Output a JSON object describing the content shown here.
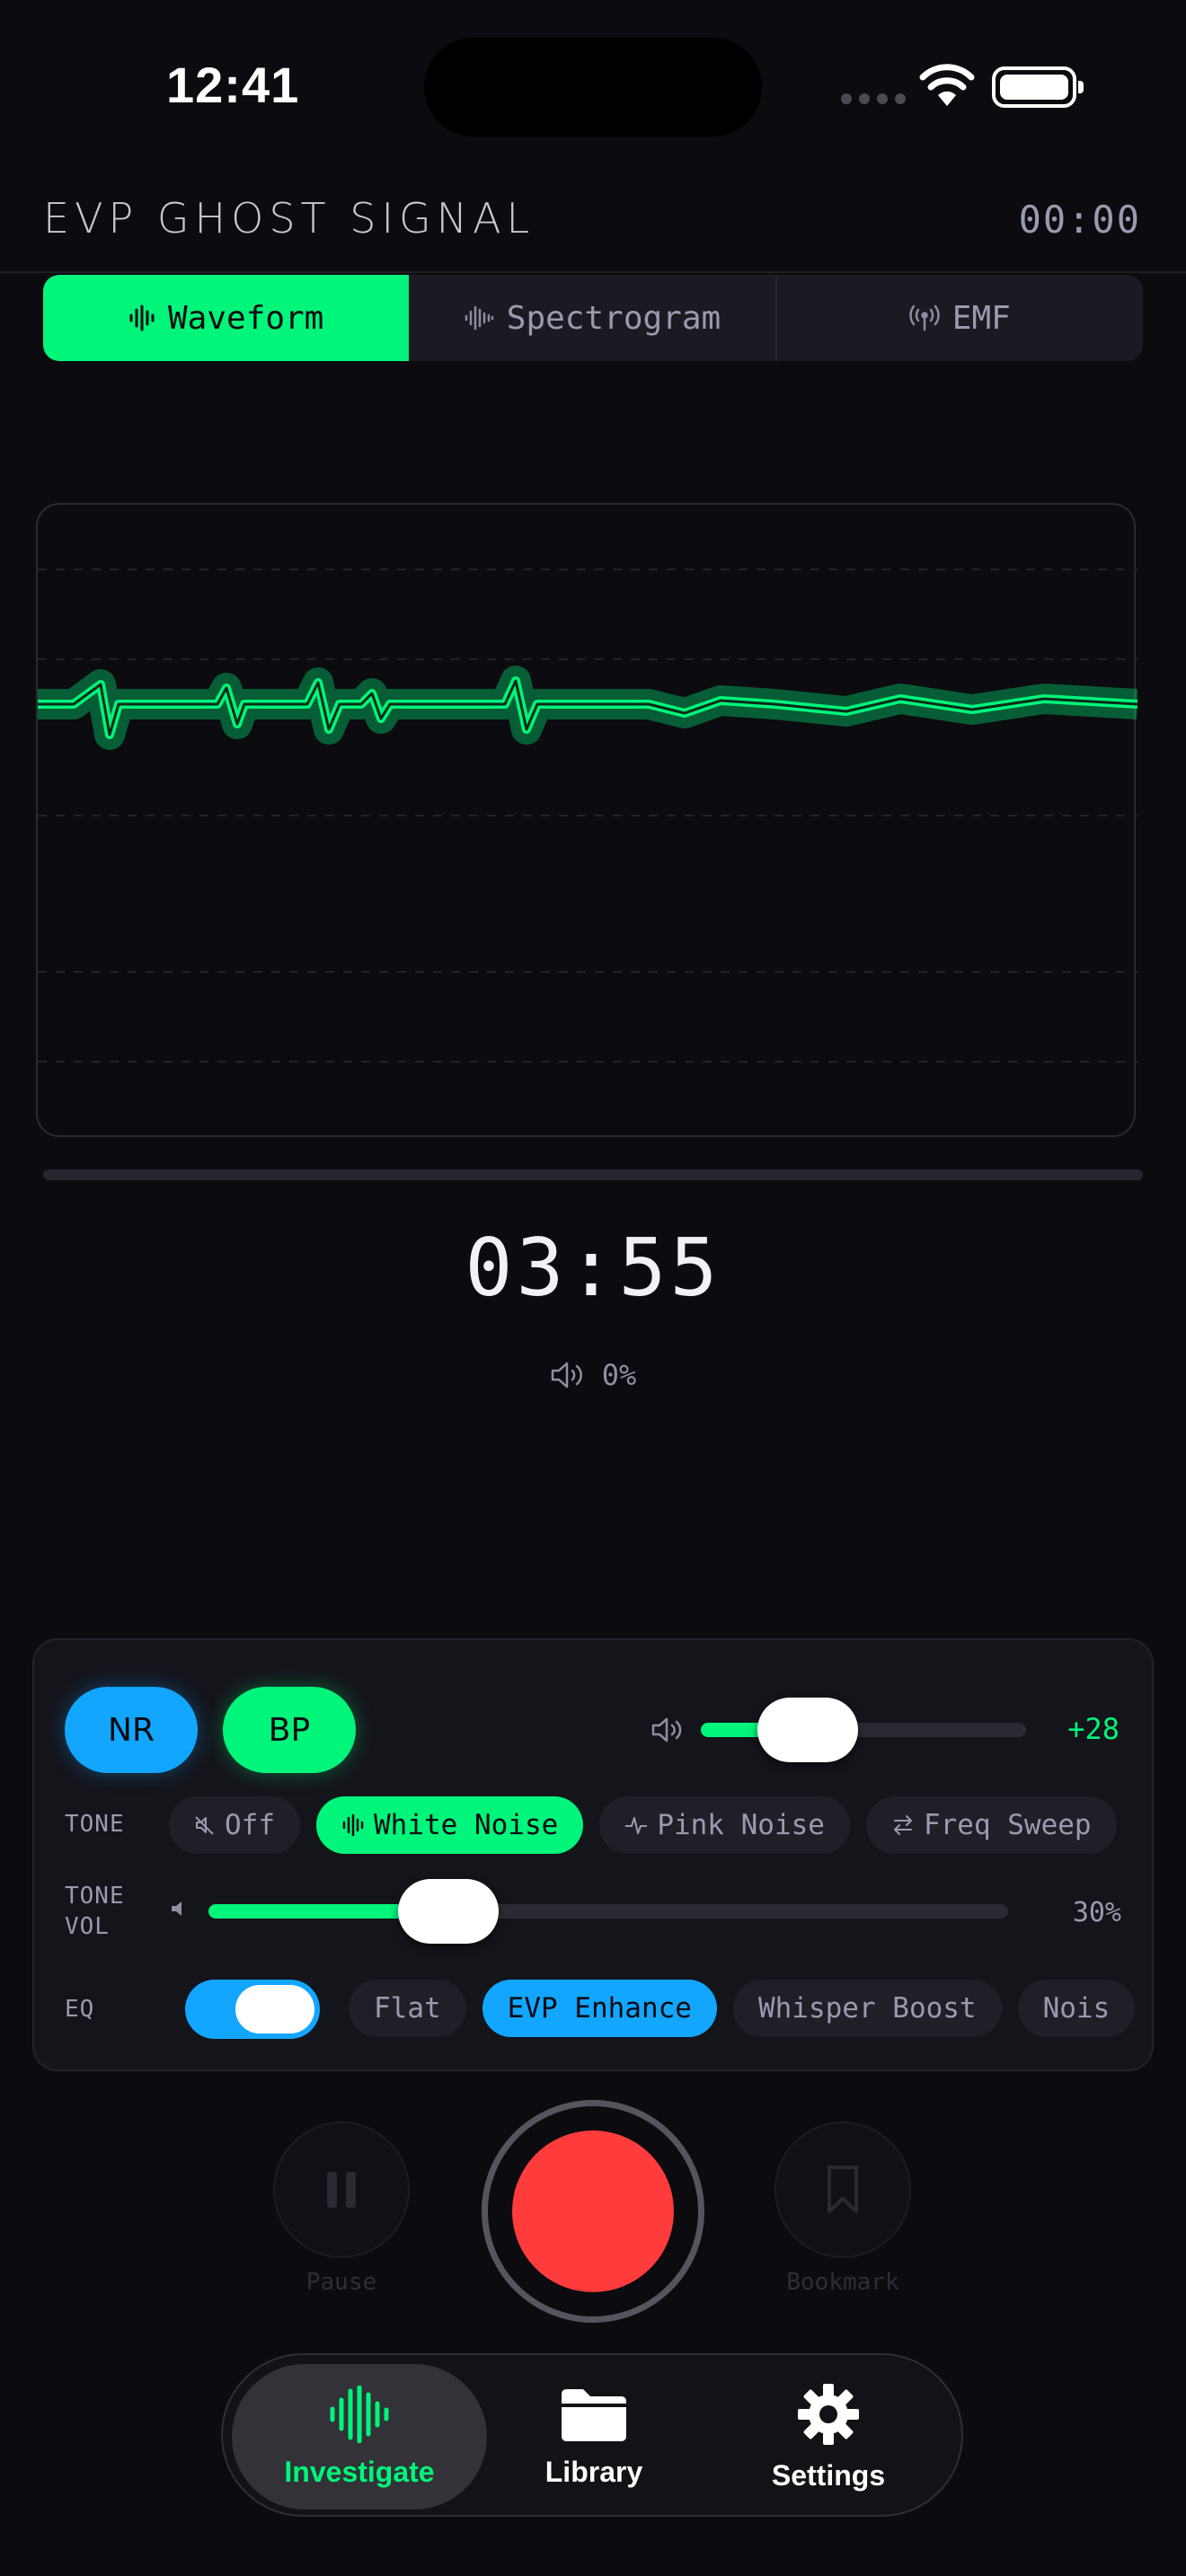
{
  "status_bar": {
    "time": "12:41"
  },
  "header": {
    "title": "EVP GHOST SIGNAL",
    "elapsed": "00:00"
  },
  "tabs": [
    {
      "label": "Waveform",
      "icon": "waveform-icon",
      "active": true
    },
    {
      "label": "Spectrogram",
      "icon": "spectrogram-icon",
      "active": false
    },
    {
      "label": "EMF",
      "icon": "antenna-icon",
      "active": false
    }
  ],
  "recording": {
    "timer": "03:55",
    "volume": "0%",
    "progress": 0
  },
  "panel": {
    "nr_label": "NR",
    "bp_label": "BP",
    "gain": {
      "value_label": "+28",
      "level": 0.33
    },
    "tone": {
      "label": "TONE",
      "options": [
        {
          "label": "Off",
          "icon": "mute-icon",
          "active": false
        },
        {
          "label": "White Noise",
          "icon": "waveform-icon",
          "active": true
        },
        {
          "label": "Pink Noise",
          "icon": "pulse-icon",
          "active": false
        },
        {
          "label": "Freq Sweep",
          "icon": "sweep-icon",
          "active": false
        }
      ]
    },
    "tone_volume": {
      "label_line1": "TONE",
      "label_line2": "VOL",
      "value_label": "30%",
      "level": 0.3
    },
    "eq": {
      "label": "EQ",
      "enabled": true,
      "presets": [
        {
          "label": "Flat",
          "active": false
        },
        {
          "label": "EVP Enhance",
          "active": true
        },
        {
          "label": "Whisper Boost",
          "active": false
        },
        {
          "label": "Nois",
          "active": false
        }
      ]
    }
  },
  "transport": {
    "pause_label": "Pause",
    "bookmark_label": "Bookmark"
  },
  "tab_bar": [
    {
      "label": "Investigate",
      "icon": "waveform-icon",
      "active": true
    },
    {
      "label": "Library",
      "icon": "folder-icon",
      "active": false
    },
    {
      "label": "Settings",
      "icon": "gear-icon",
      "active": false
    }
  ],
  "colors": {
    "accent_green": "#00f57a",
    "accent_blue": "#12a6ff",
    "record_red": "#ff3b3b",
    "background": "#0b0b10"
  }
}
